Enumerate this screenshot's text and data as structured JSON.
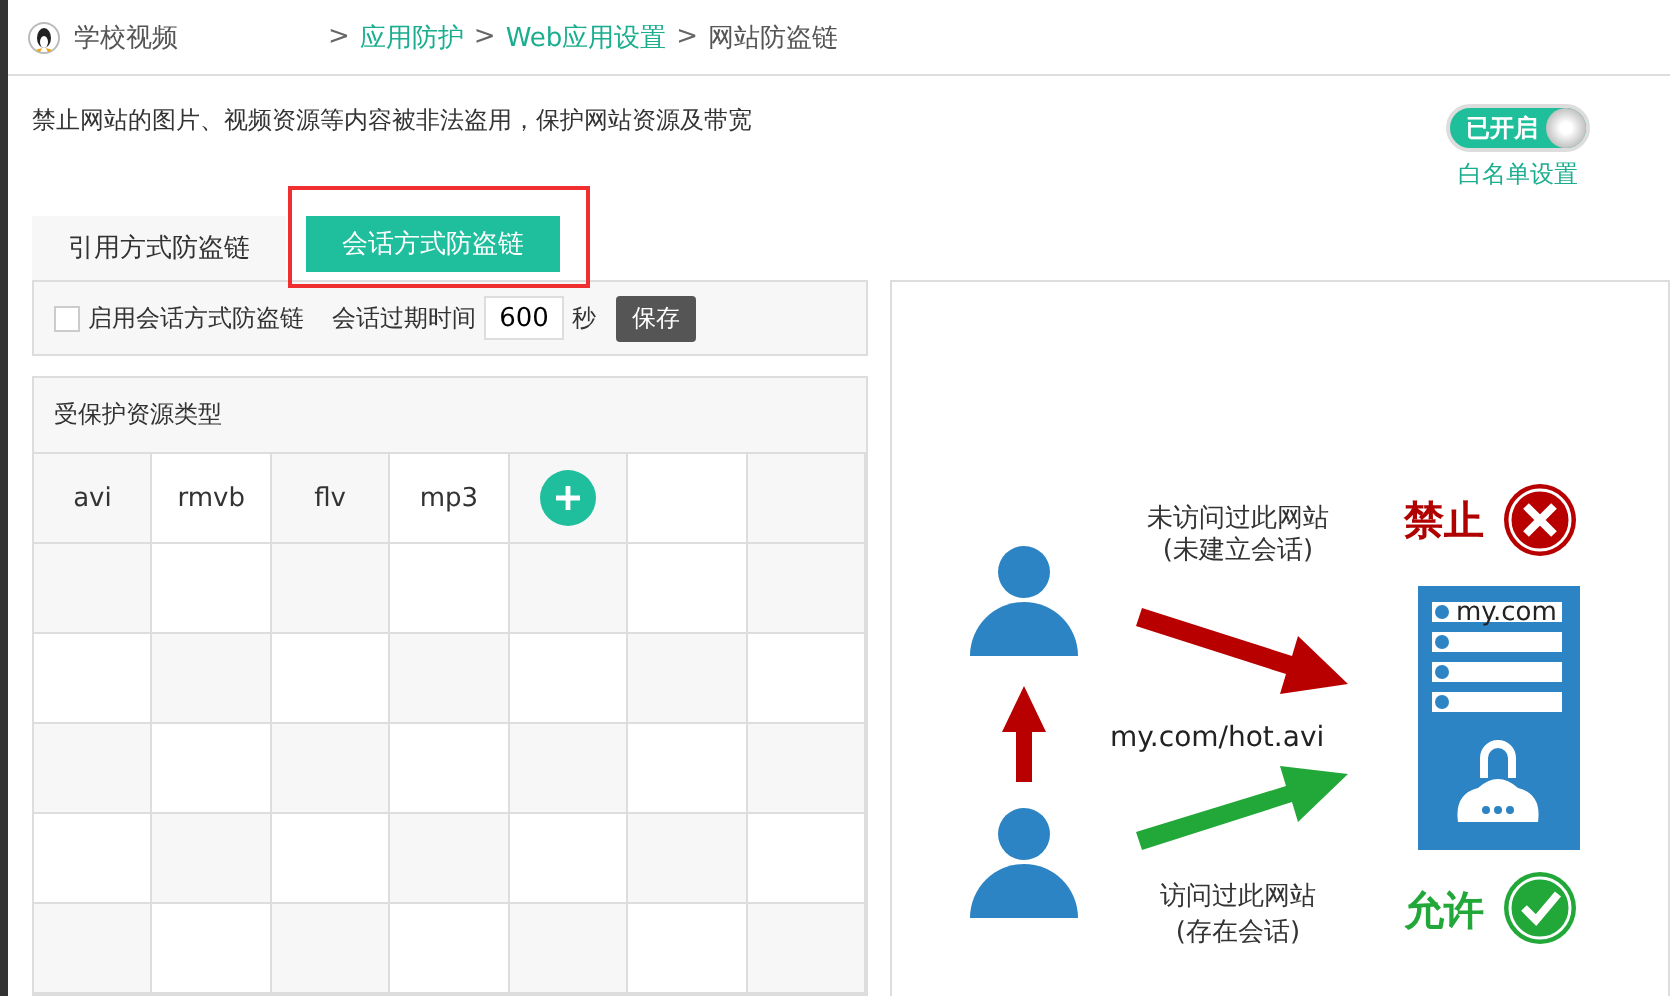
{
  "breadcrumb": [
    {
      "label": "学校视频",
      "link": false
    },
    {
      "label": "应用防护",
      "link": true
    },
    {
      "label": "Web应用设置",
      "link": true
    },
    {
      "label": "网站防盗链",
      "link": false
    }
  ],
  "separator": ">",
  "description": "禁止网站的图片、视频资源等内容被非法盗用，保护网站资源及带宽",
  "switch": {
    "label": "已开启",
    "on": true
  },
  "whitelist_link": "白名单设置",
  "tabs": [
    {
      "label": "引用方式防盗链",
      "selected": false,
      "highlighted": false
    },
    {
      "label": "会话方式防盗链",
      "selected": true,
      "highlighted": true
    }
  ],
  "settings": {
    "checkbox_label": "启用会话方式防盗链",
    "checked": false,
    "expire_label": "会话过期时间",
    "expire_value": "600",
    "unit": "秒",
    "save": "保存"
  },
  "resource_table": {
    "title": "受保护资源类型",
    "types": [
      "avi",
      "rmvb",
      "flv",
      "mp3"
    ]
  },
  "diagram": {
    "denied_caption": [
      "未访问过此网站",
      "(未建立会话)"
    ],
    "denied_label": "禁止",
    "url": "my.com/hot.avi",
    "server_label": "my.com",
    "allowed_caption": [
      "访问过此网站",
      "(存在会话)"
    ],
    "allowed_label": "允许"
  }
}
